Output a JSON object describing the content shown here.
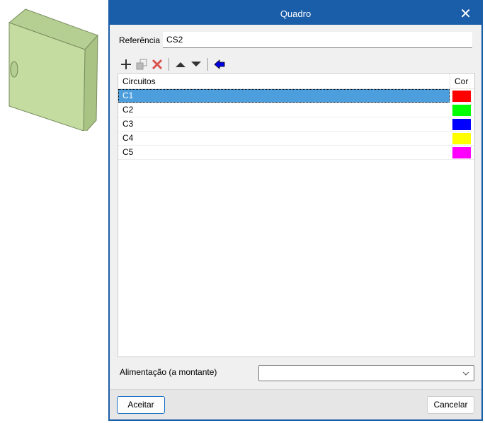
{
  "dialog": {
    "title": "Quadro",
    "close_label": "✕"
  },
  "reference": {
    "label": "Referência",
    "value": "CS2"
  },
  "toolbar": {
    "icons": [
      "plus-icon",
      "copy-icon",
      "delete-icon",
      "arrow-up-icon",
      "arrow-down-icon",
      "arrow-left-icon"
    ]
  },
  "table": {
    "headers": {
      "name": "Circuitos",
      "color": "Cor"
    },
    "rows": [
      {
        "name": "C1",
        "color": "#ff0000"
      },
      {
        "name": "C2",
        "color": "#00ff00"
      },
      {
        "name": "C3",
        "color": "#0000ff"
      },
      {
        "name": "C4",
        "color": "#ffff00"
      },
      {
        "name": "C5",
        "color": "#ff00ff"
      }
    ]
  },
  "supply": {
    "label": "Alimentação (a montante)",
    "value": ""
  },
  "buttons": {
    "accept": "Aceitar",
    "cancel": "Cancelar"
  }
}
